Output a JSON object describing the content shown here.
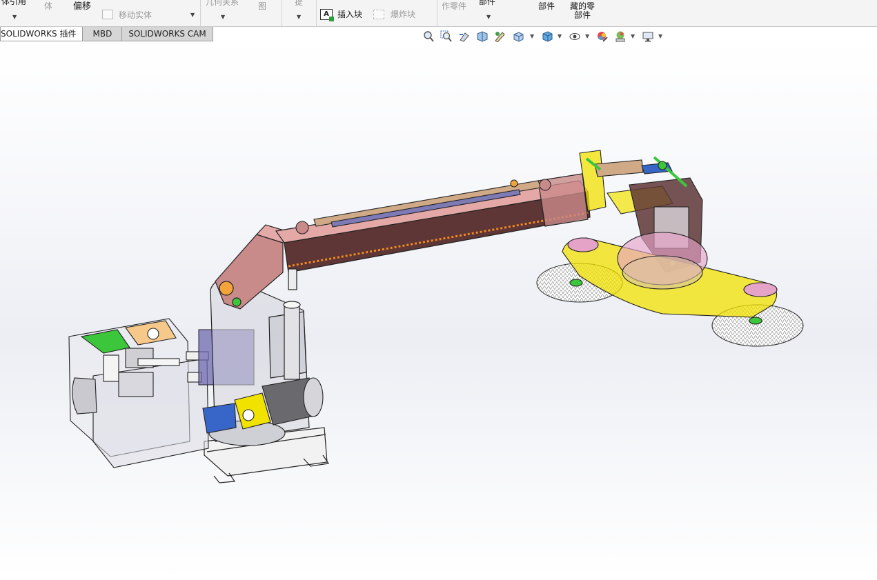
{
  "ribbon": {
    "convert_entities": "体引用",
    "extrude_body": "体",
    "offset": "偏移",
    "move_entities": "移动实体",
    "relations": "几何关系",
    "map": "图",
    "hint": "提",
    "insert_block": "插入块",
    "explode_block": "爆炸块",
    "make_part": "作零件",
    "part": "部件",
    "part2": "部件",
    "hidden_part": "藏的零",
    "hidden_part2": "部件"
  },
  "tabs": [
    {
      "label": "SOLIDWORKS 插件",
      "active": true
    },
    {
      "label": "MBD",
      "active": false
    },
    {
      "label": "SOLIDWORKS CAM",
      "active": false
    }
  ],
  "hud": {
    "icons": [
      "zoom-to-fit-icon",
      "zoom-to-area-icon",
      "previous-view-icon",
      "section-view-icon",
      "dynamic-annotation-icon",
      "view-orientation-icon",
      "display-style-icon",
      "hide-show-icon",
      "edit-appearance-icon",
      "apply-scene-icon",
      "view-settings-icon"
    ]
  },
  "colors": {
    "arm_red": "#c98a8a",
    "arm_dark": "#5e3636",
    "yellow": "#f2e200",
    "green": "#3cc63c",
    "blue": "#3866c8",
    "purple": "#7d7ab6"
  }
}
